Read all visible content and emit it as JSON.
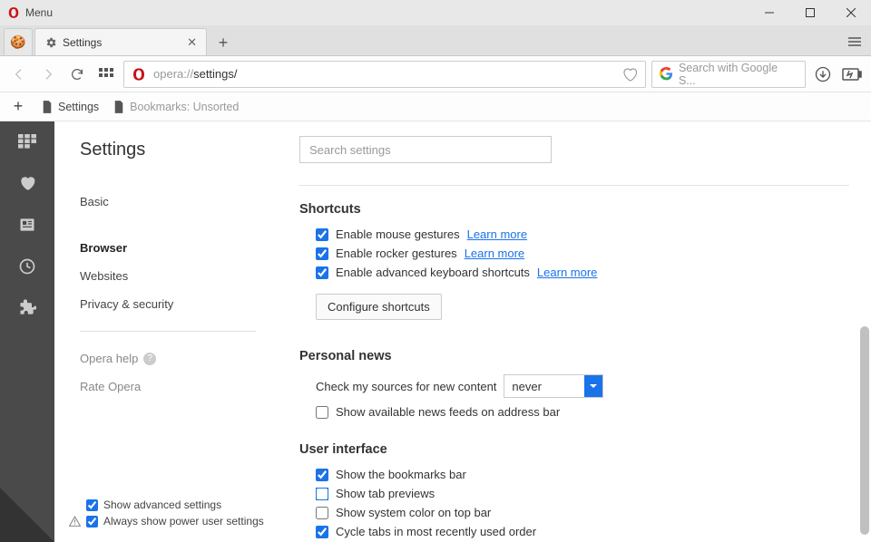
{
  "window": {
    "title": "Menu"
  },
  "tabs": {
    "active": {
      "label": "Settings"
    }
  },
  "address": {
    "prefix": "opera://",
    "page": "settings/",
    "search_placeholder": "Search with Google S..."
  },
  "bookmarks_bar": {
    "items": [
      "Settings",
      "Bookmarks: Unsorted"
    ]
  },
  "settings": {
    "title": "Settings",
    "nav": [
      "Basic",
      "Browser",
      "Websites",
      "Privacy & security"
    ],
    "help": "Opera help",
    "rate": "Rate Opera",
    "show_adv": "Show advanced settings",
    "show_power": "Always show power user settings",
    "search_placeholder": "Search settings"
  },
  "sections": {
    "shortcuts": {
      "title": "Shortcuts",
      "mouse": "Enable mouse gestures",
      "rocker": "Enable rocker gestures",
      "keyboard": "Enable advanced keyboard shortcuts",
      "learn": "Learn more",
      "configure": "Configure shortcuts"
    },
    "news": {
      "title": "Personal news",
      "check_label": "Check my sources for new content",
      "check_value": "never",
      "feeds": "Show available news feeds on address bar"
    },
    "ui": {
      "title": "User interface",
      "bookmarks": "Show the bookmarks bar",
      "previews": "Show tab previews",
      "syscolor": "Show system color on top bar",
      "cycle": "Cycle tabs in most recently used order"
    }
  }
}
